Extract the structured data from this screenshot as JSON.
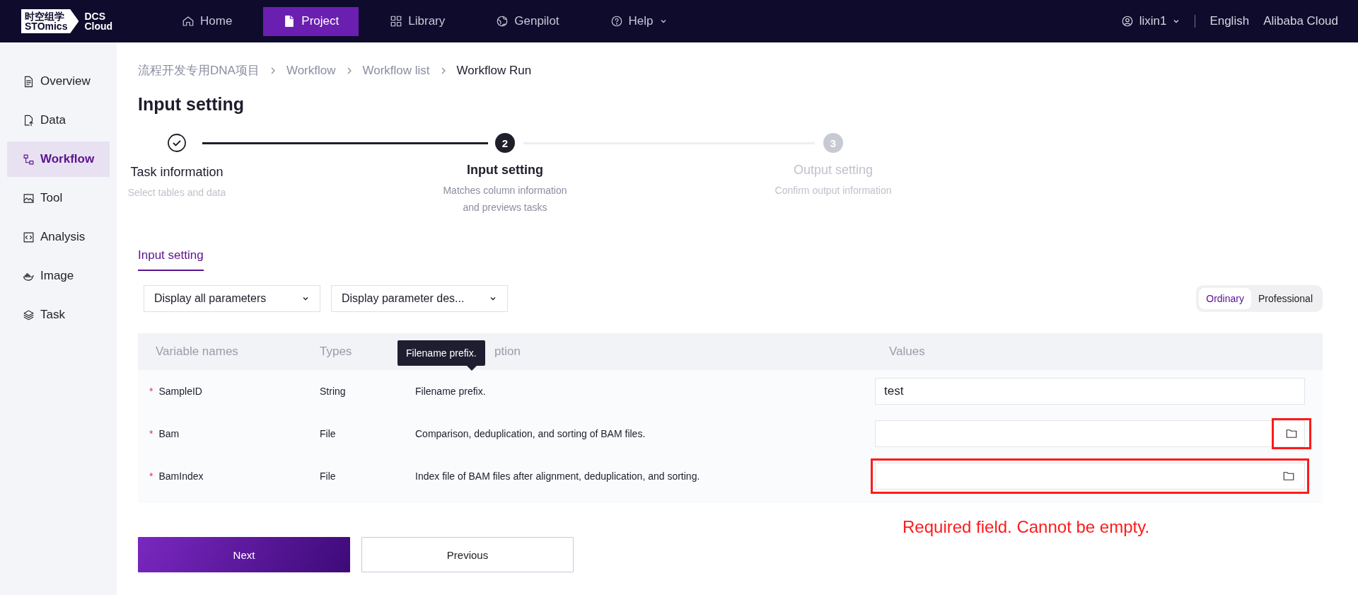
{
  "topbar": {
    "logo_cn": "时空组学",
    "logo_en": "STOmics",
    "product_line1": "DCS",
    "product_line2": "Cloud",
    "nav": [
      {
        "label": "Home",
        "selected": false,
        "dropdown": false
      },
      {
        "label": "Project",
        "selected": true,
        "dropdown": false
      },
      {
        "label": "Library",
        "selected": false,
        "dropdown": false
      },
      {
        "label": "Genpilot",
        "selected": false,
        "dropdown": false
      },
      {
        "label": "Help",
        "selected": false,
        "dropdown": true
      }
    ],
    "user": "lixin1",
    "language": "English",
    "cloud": "Alibaba Cloud"
  },
  "sidebar": {
    "items": [
      {
        "label": "Overview",
        "selected": false
      },
      {
        "label": "Data",
        "selected": false
      },
      {
        "label": "Workflow",
        "selected": true
      },
      {
        "label": "Tool",
        "selected": false
      },
      {
        "label": "Analysis",
        "selected": false
      },
      {
        "label": "Image",
        "selected": false
      },
      {
        "label": "Task",
        "selected": false
      }
    ]
  },
  "breadcrumb": [
    "流程开发专用DNA项目",
    "Workflow",
    "Workflow list",
    "Workflow Run"
  ],
  "page_title": "Input setting",
  "steps": [
    {
      "title": "Task information",
      "description": "Select tables and data",
      "done": true,
      "selected": false
    },
    {
      "title": "Input setting",
      "description": "Matches column information and previews tasks",
      "number": "2",
      "done": false,
      "selected": true
    },
    {
      "title": "Output setting",
      "description": "Confirm output information",
      "number": "3",
      "done": false,
      "selected": false
    }
  ],
  "tabs": [
    {
      "label": "Input setting",
      "selected": true
    }
  ],
  "filters": [
    {
      "value": "Display all parameters"
    },
    {
      "value": "Display parameter des..."
    }
  ],
  "mode_toggle": [
    {
      "label": "Ordinary",
      "selected": true
    },
    {
      "label": "Professional",
      "selected": false
    }
  ],
  "table": {
    "columns": [
      "Variable names",
      "Types",
      "ption",
      "Values"
    ],
    "tooltip": "Filename prefix.",
    "rows": [
      {
        "required_mark": "*",
        "name": "SampleID",
        "type": "String",
        "description": "Filename prefix.",
        "value": "test",
        "kind": "text",
        "field_highlighted": false
      },
      {
        "required_mark": "*",
        "name": "Bam",
        "type": "File",
        "description": "Comparison, deduplication, and sorting of BAM files.",
        "kind": "file",
        "icon_highlighted": true,
        "field_highlighted": false
      },
      {
        "required_mark": "*",
        "name": "BamIndex",
        "type": "File",
        "description": "Index file of BAM files after alignment, deduplication, and sorting.",
        "kind": "file",
        "icon_highlighted": false,
        "field_highlighted": true
      }
    ]
  },
  "annotation": "Required field. Cannot be empty.",
  "buttons": [
    {
      "label": "Next",
      "kind": "primary"
    },
    {
      "label": "Previous",
      "kind": "secondary"
    }
  ]
}
